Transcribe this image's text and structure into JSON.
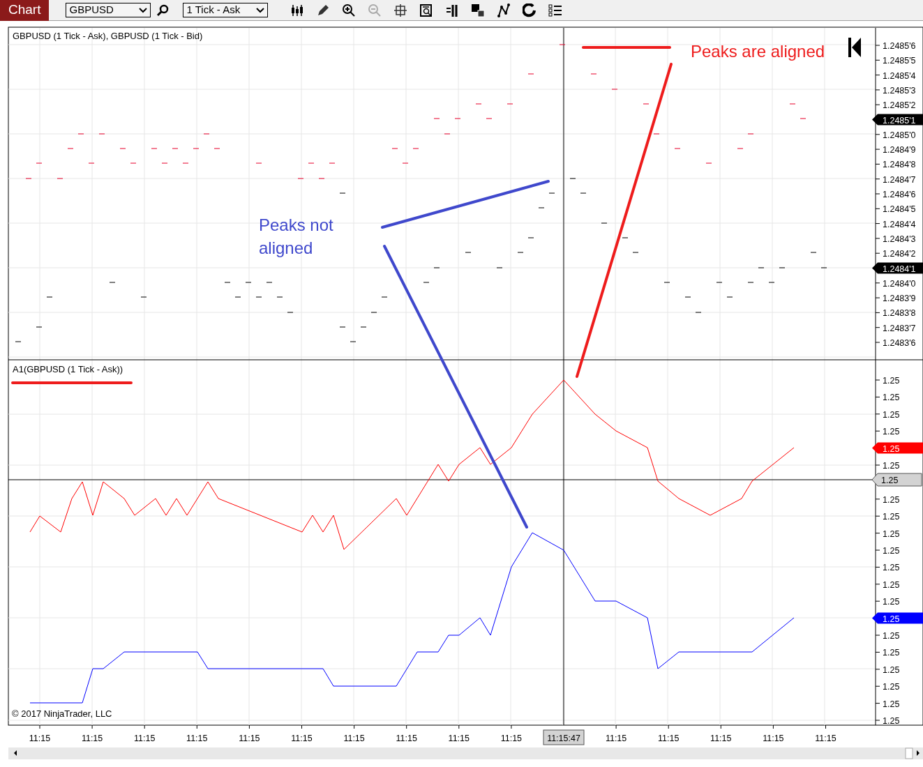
{
  "toolbar": {
    "title": "Chart",
    "instrument": "GBPUSD",
    "series_type": "1 Tick - Ask"
  },
  "upper_panel": {
    "title": "GBPUSD (1 Tick - Ask), GBPUSD (1 Tick - Bid)",
    "price_axis": [
      {
        "label": "1.2485'6",
        "kind": "tick"
      },
      {
        "label": "1.2485'5",
        "kind": "tick"
      },
      {
        "label": "1.2485'4",
        "kind": "tick"
      },
      {
        "label": "1.2485'3",
        "kind": "tick"
      },
      {
        "label": "1.2485'2",
        "kind": "tick"
      },
      {
        "label": "1.2485'1",
        "kind": "marker",
        "color": "#000000"
      },
      {
        "label": "1.2485'0",
        "kind": "tick"
      },
      {
        "label": "1.2484'9",
        "kind": "tick"
      },
      {
        "label": "1.2484'8",
        "kind": "tick"
      },
      {
        "label": "1.2484'7",
        "kind": "tick"
      },
      {
        "label": "1.2484'6",
        "kind": "tick"
      },
      {
        "label": "1.2484'5",
        "kind": "tick"
      },
      {
        "label": "1.2484'4",
        "kind": "tick"
      },
      {
        "label": "1.2484'3",
        "kind": "tick"
      },
      {
        "label": "1.2484'2",
        "kind": "tick"
      },
      {
        "label": "1.2484'1",
        "kind": "marker",
        "color": "#000000"
      },
      {
        "label": "1.2484'0",
        "kind": "tick"
      },
      {
        "label": "1.2483'9",
        "kind": "tick"
      },
      {
        "label": "1.2483'8",
        "kind": "tick"
      },
      {
        "label": "1.2483'7",
        "kind": "tick"
      },
      {
        "label": "1.2483'6",
        "kind": "tick"
      }
    ]
  },
  "lower_panel": {
    "title": "A1(GBPUSD (1 Tick - Ask))",
    "copyright": "© 2017 NinjaTrader, LLC",
    "price_axis": [
      {
        "label": "1.25",
        "kind": "tick"
      },
      {
        "label": "1.25",
        "kind": "tick"
      },
      {
        "label": "1.25",
        "kind": "tick"
      },
      {
        "label": "1.25",
        "kind": "tick"
      },
      {
        "label": "1.25",
        "kind": "marker",
        "color": "#ff0000"
      },
      {
        "label": "1.25",
        "kind": "tick"
      },
      {
        "label": "1.25",
        "kind": "crosshair",
        "color": "#d3d3d3"
      },
      {
        "label": "1.25",
        "kind": "tick"
      },
      {
        "label": "1.25",
        "kind": "tick"
      },
      {
        "label": "1.25",
        "kind": "tick"
      },
      {
        "label": "1.25",
        "kind": "tick"
      },
      {
        "label": "1.25",
        "kind": "tick"
      },
      {
        "label": "1.25",
        "kind": "tick"
      },
      {
        "label": "1.25",
        "kind": "tick"
      },
      {
        "label": "1.25",
        "kind": "marker",
        "color": "#0000ff"
      },
      {
        "label": "1.25",
        "kind": "tick"
      },
      {
        "label": "1.25",
        "kind": "tick"
      },
      {
        "label": "1.25",
        "kind": "tick"
      },
      {
        "label": "1.25",
        "kind": "tick"
      },
      {
        "label": "1.25",
        "kind": "tick"
      },
      {
        "label": "1.25",
        "kind": "tick"
      }
    ]
  },
  "time_axis": [
    {
      "label": "11:15",
      "selected": false
    },
    {
      "label": "11:15",
      "selected": false
    },
    {
      "label": "11:15",
      "selected": false
    },
    {
      "label": "11:15",
      "selected": false
    },
    {
      "label": "11:15",
      "selected": false
    },
    {
      "label": "11:15",
      "selected": false
    },
    {
      "label": "11:15",
      "selected": false
    },
    {
      "label": "11:15",
      "selected": false
    },
    {
      "label": "11:15",
      "selected": false
    },
    {
      "label": "11:15",
      "selected": false
    },
    {
      "label": "11:15:47",
      "selected": true
    },
    {
      "label": "11:15",
      "selected": false
    },
    {
      "label": "11:15",
      "selected": false
    },
    {
      "label": "11:15",
      "selected": false
    },
    {
      "label": "11:15",
      "selected": false
    },
    {
      "label": "11:15",
      "selected": false
    }
  ],
  "annotations": [
    {
      "text": "Peaks are aligned",
      "color": "#ee1c1c"
    },
    {
      "text": "Peaks not aligned",
      "color": "#3f48cc"
    }
  ]
}
